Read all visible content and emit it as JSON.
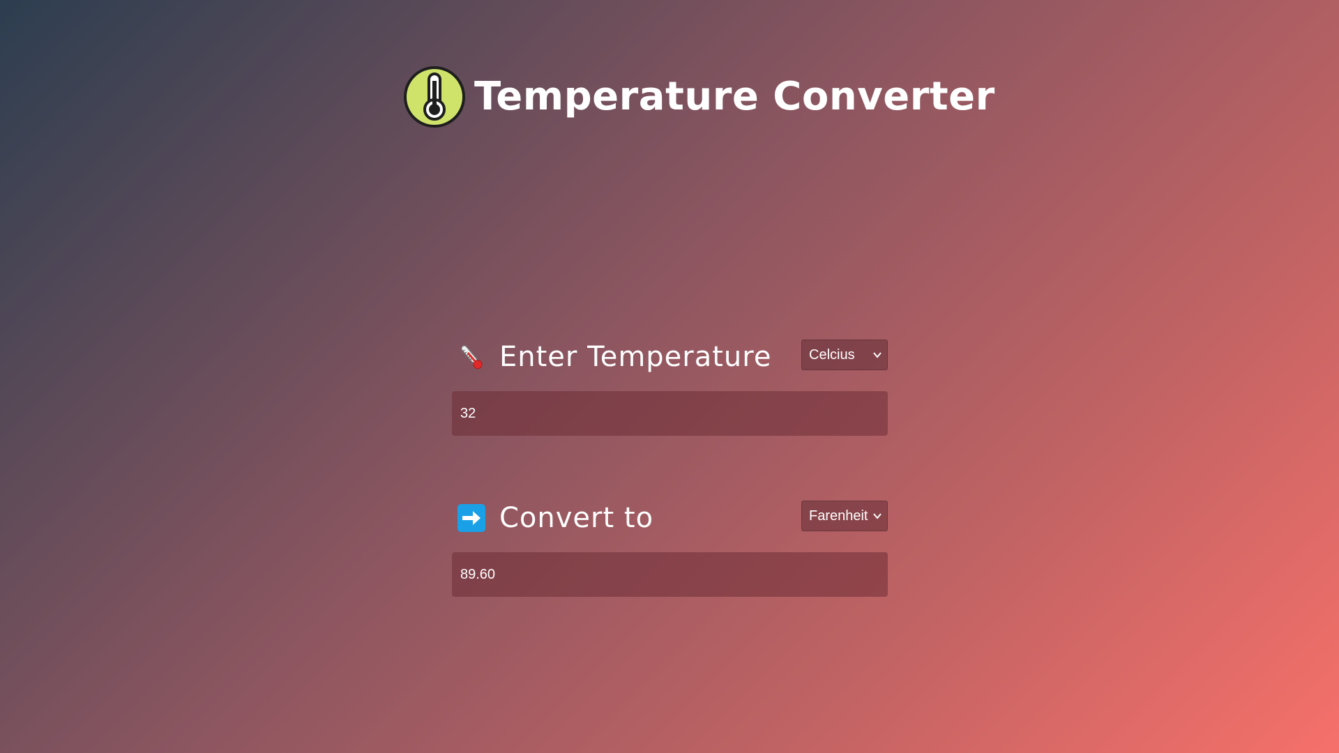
{
  "app": {
    "title": "Temperature Converter",
    "logo_icon": "thermometer-logo-icon"
  },
  "input_section": {
    "icon": "thermometer-emoji-icon",
    "label": "Enter Temperature",
    "unit_selected": "Celcius",
    "value": "32"
  },
  "output_section": {
    "icon": "right-arrow-emoji-icon",
    "label": "Convert to",
    "unit_selected": "Farenheit",
    "value": "89.60"
  },
  "colors": {
    "background_start": "#2c3e50",
    "background_end": "#f6706a",
    "logo_fill": "#cfe36b",
    "arrow_tile": "#1aa0e6"
  }
}
